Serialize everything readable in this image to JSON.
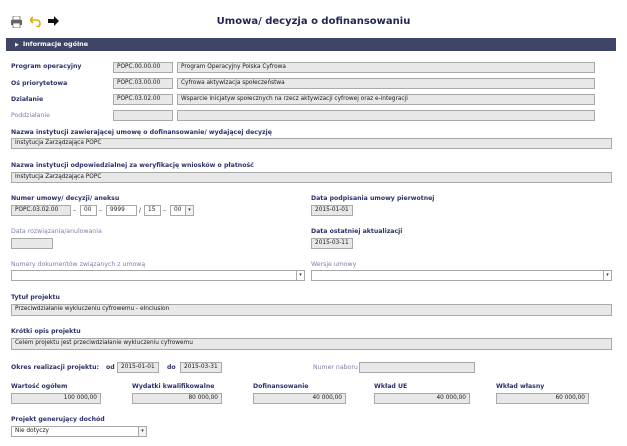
{
  "title": "Umowa/ decyzja o dofinansowaniu",
  "section_header": "Informacje ogólne",
  "program": {
    "label": "Program operacyjny",
    "code": "POPC.00.00.00",
    "name": "Program Operacyjny Polska Cyfrowa"
  },
  "os": {
    "label": "Oś priorytetowa",
    "code": "POPC.03.00.00",
    "name": "Cyfrowa aktywizacja społeczeństwa"
  },
  "dzialanie": {
    "label": "Działanie",
    "code": "POPC.03.02.00",
    "name": "Wsparcie inicjatyw społecznych na rzecz aktywizacji cyfrowej oraz e-integracji"
  },
  "poddzialanie": {
    "label": "Poddziałanie",
    "code": "",
    "name": ""
  },
  "instytucja_zawierajaca": {
    "label": "Nazwa instytucji zawierającej umowę o dofinansowanie/ wydającej decyzję",
    "value": "Instytucja Zarządzająca POPC"
  },
  "instytucja_odpowiedzialna": {
    "label": "Nazwa instytucji odpowiedzialnej za weryfikację wniosków o płatność",
    "value": "Instytucja Zarządzająca POPC"
  },
  "numer_umowy": {
    "label": "Numer umowy/ decyzji/ aneksu",
    "part1": "POPC.03.02.00",
    "part2": "00",
    "part3": "9999",
    "part4": "15",
    "part5": "00",
    "sep_dash": "–",
    "sep_slash": "/"
  },
  "data_podpisania": {
    "label": "Data podpisania umowy pierwotnej",
    "value": "2015-01-01"
  },
  "data_rozwiazania": {
    "label": "Data rozwiązania/anulowania",
    "value": ""
  },
  "data_aktualizacji": {
    "label": "Data ostatniej aktualizacji",
    "value": "2015-03-11"
  },
  "numery_dokumentow": {
    "label": "Numery dokumentów związanych z umową",
    "value": ""
  },
  "wersje_umowy": {
    "label": "Wersje umowy",
    "value": ""
  },
  "tytul_projektu": {
    "label": "Tytuł projektu",
    "value": "Przeciwdziałanie wykluczeniu cyfrowemu - eInclusion"
  },
  "opis_projektu": {
    "label": "Krótki opis projektu",
    "value": "Celem projektu jest przeciwdziałanie wykluczeniu cyfrowemu"
  },
  "okres": {
    "label": "Okres realizacji projektu:",
    "od_label": "od",
    "od": "2015-01-01",
    "do_label": "do",
    "do": "2015-03-31"
  },
  "numer_naboru": {
    "label": "Numer naboru",
    "value": ""
  },
  "finanse": [
    {
      "label": "Wartość ogółem",
      "value": "100 000,00"
    },
    {
      "label": "Wydatki kwalifikowalne",
      "value": "80 000,00"
    },
    {
      "label": "Dofinansowanie",
      "value": "40 000,00"
    },
    {
      "label": "Wkład UE",
      "value": "40 000,00"
    },
    {
      "label": "Wkład własny",
      "value": "60 000,00"
    }
  ],
  "projekt_dochod": {
    "label": "Projekt generujący dochód",
    "value": "Nie dotyczy"
  },
  "icons": [
    "print-icon",
    "undo-icon",
    "forward-arrow-icon",
    "chevron-down-icon",
    "triangle-right-icon"
  ],
  "colors": {
    "header_bar": "#3f4566",
    "label_text": "#2b3069",
    "title_text": "#1f2550",
    "print_icon": "#666666",
    "undo_icon": "#d9b200"
  }
}
